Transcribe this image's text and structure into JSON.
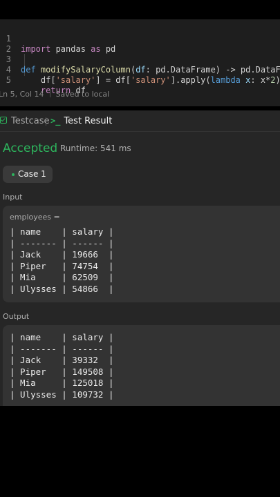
{
  "editor": {
    "line_numbers": [
      "1",
      "2",
      "3",
      "4",
      "5"
    ],
    "status": {
      "position": "Ln 5, Col 14",
      "saved": "Saved to local"
    }
  },
  "tabs": {
    "testcase": "Testcase",
    "result": "Test Result"
  },
  "result": {
    "verdict": "Accepted",
    "runtime": "Runtime: 541 ms",
    "case_label": "Case 1",
    "input_label": "Input",
    "input_var": "employees =",
    "input_table": [
      "| name    | salary |",
      "| ------- | ------ |",
      "| Jack    | 19666  |",
      "| Piper   | 74754  |",
      "| Mia     | 62509  |",
      "| Ulysses | 54866  |"
    ],
    "output_label": "Output",
    "output_table": [
      "| name    | salary |",
      "| ------- | ------ |",
      "| Jack    | 39332  |",
      "| Piper   | 149508 |",
      "| Mia     | 125018 |",
      "| Ulysses | 109732 |"
    ]
  },
  "colors": {
    "accent_green": "#2db55d",
    "panel_bg": "#262626",
    "editor_bg": "#1e1e1e"
  },
  "icons": [
    "check-icon",
    "terminal-icon"
  ]
}
